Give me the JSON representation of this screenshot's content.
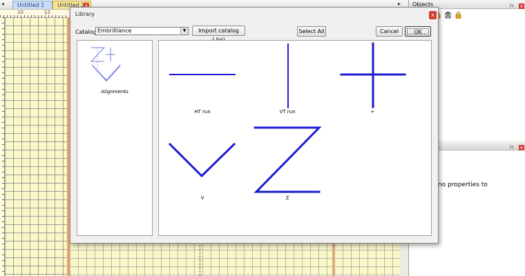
{
  "app": {
    "tabs": [
      {
        "label": "Untitled 1"
      },
      {
        "label": "Untitled 2"
      }
    ],
    "tab_close_glyph": "x",
    "tab_prev_glyph": "◂",
    "tab_next_glyph": "▸",
    "ruler_labels": [
      "10",
      "12"
    ]
  },
  "objects_panel": {
    "title": "Objects",
    "pin_glyph": "⊓",
    "close_glyph": "x",
    "tool_icons": [
      "lock-icon",
      "delete-icon",
      "lock-icon"
    ]
  },
  "properties_panel": {
    "pin_glyph": "⊓",
    "close_glyph": "x",
    "message": "re no properties to"
  },
  "dialog": {
    "title": "Library",
    "close_glyph": "x",
    "catalog_label": "Catalog:",
    "catalog_value": "Embrilliance",
    "import_button": "Import catalog (.bx)",
    "select_all_button": "Select All",
    "cancel_button": "Cancel",
    "ok_button": "OK",
    "catalogs": [
      {
        "label": "Alignments",
        "icon": "alignments-icon"
      }
    ],
    "shapes": [
      {
        "label": "HT run",
        "icon": "horizontal-line-icon"
      },
      {
        "label": "VT run",
        "icon": "vertical-line-icon"
      },
      {
        "label": "+",
        "icon": "plus-icon"
      },
      {
        "label": "V",
        "icon": "v-shape-icon"
      },
      {
        "label": "Z",
        "icon": "z-shape-icon"
      }
    ]
  },
  "colors": {
    "shape_stroke": "#1a1ad0",
    "grid_paper": "#fbf8c8",
    "page_border": "#e4a66d",
    "close_red": "#d13b30"
  }
}
